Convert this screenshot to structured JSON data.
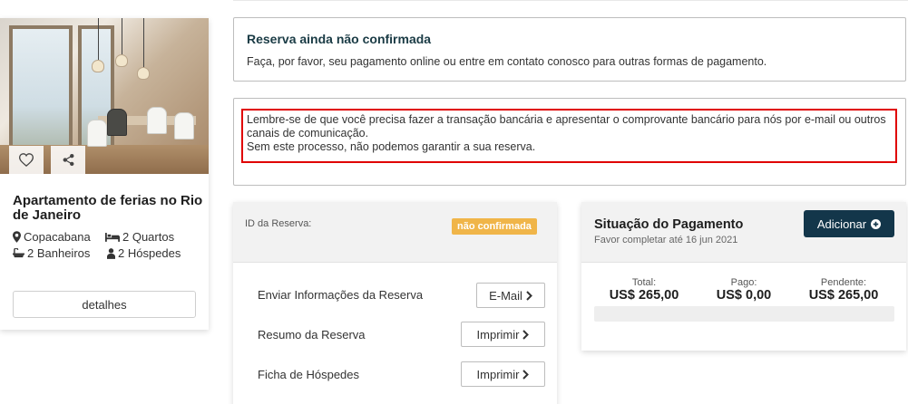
{
  "property": {
    "title": "Apartamento de ferias no Rio de Janeiro",
    "location": "Copacabana",
    "bedrooms": "2 Quartos",
    "bathrooms": "2 Banheiros",
    "guests": "2 Hóspedes",
    "details_label": "detalhes",
    "icons": {
      "favorite": "heart-icon",
      "share": "share-icon",
      "location": "map-pin-icon",
      "bed": "bed-icon",
      "bath": "bath-icon",
      "guests": "user-icon"
    }
  },
  "notices": {
    "unconfirmed_title": "Reserva ainda não confirmada",
    "unconfirmed_text": "Faça, por favor, seu pagamento online ou entre em contato conosco para outras formas de pagamento.",
    "reminder_line1": "Lembre-se de que você precisa fazer a transação bancária e apresentar o comprovante bancário para nós por e-mail ou outros canais de comunicação.",
    "reminder_line2": "Sem este processo, não podemos garantir a sua reserva."
  },
  "reservation": {
    "id_label": "ID da Reserva:",
    "status_badge": "não confirmada",
    "rows": [
      {
        "label": "Enviar Informações da Reserva",
        "button": "E-Mail"
      },
      {
        "label": "Resumo da Reserva",
        "button": "Imprimir"
      },
      {
        "label": "Ficha de Hóspedes",
        "button": "Imprimir"
      }
    ]
  },
  "payment": {
    "title": "Situação do Pagamento",
    "subtitle": "Favor completar até 16 jun 2021",
    "add_label": "Adicionar",
    "total_label": "Total:",
    "total_value": "US$ 265,00",
    "paid_label": "Pago:",
    "paid_value": "US$ 0,00",
    "pending_label": "Pendente:",
    "pending_value": "US$ 265,00",
    "progress_paid_fraction": 0
  },
  "colors": {
    "accent_dark": "#13364a",
    "badge": "#f0b549",
    "highlight_border": "#e00000"
  }
}
